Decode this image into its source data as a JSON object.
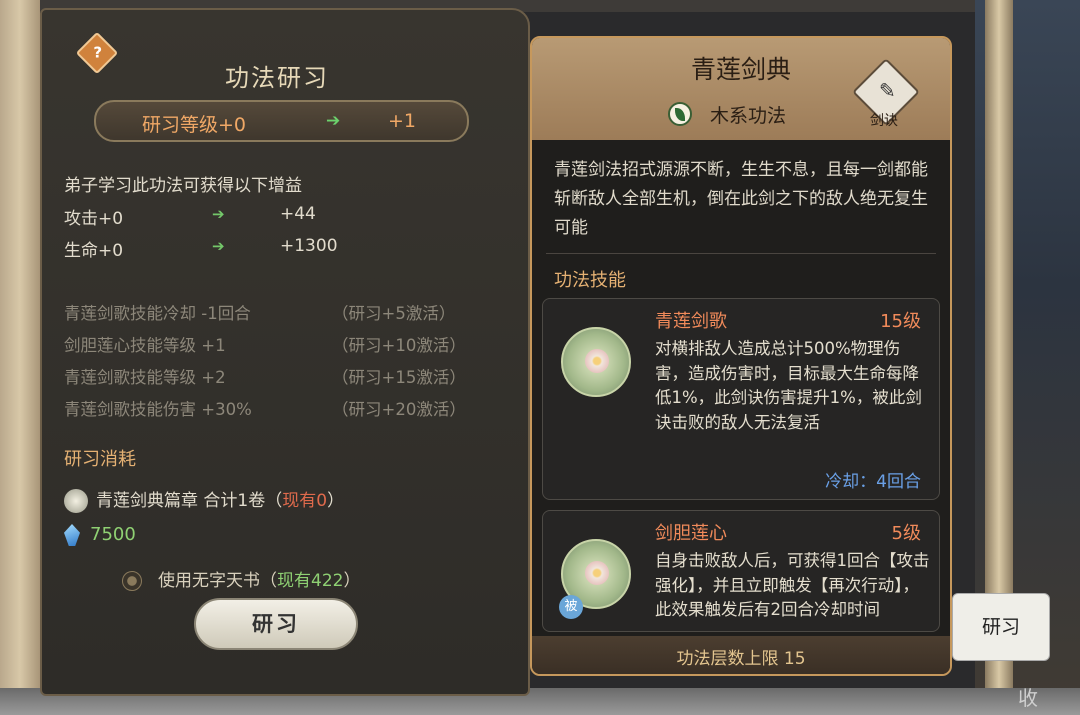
{
  "left": {
    "help": "?",
    "title": "功法研习",
    "level_label": "研习等级+0",
    "level_arrow": "➔",
    "level_next": "+1",
    "gain_heading": "弟子学习此功法可获得以下增益",
    "stats": [
      {
        "name": "攻击+0",
        "value": "+44"
      },
      {
        "name": "生命+0",
        "value": "+1300"
      }
    ],
    "bonuses": [
      {
        "name": "青莲剑歌技能冷却 -1回合",
        "cond": "（研习+5激活）"
      },
      {
        "name": "剑胆莲心技能等级 +1",
        "cond": "（研习+10激活）"
      },
      {
        "name": "青莲剑歌技能等级 +2",
        "cond": "（研习+15激活）"
      },
      {
        "name": "青莲剑歌技能伤害 +30%",
        "cond": "（研习+20激活）"
      }
    ],
    "cost_title": "研习消耗",
    "cost_item": "青莲剑典篇章 合计1卷（",
    "cost_have": "现有0",
    "cost_close": "）",
    "stone_amount": "7500",
    "book_option": "使用无字天书（",
    "book_have": "现有422",
    "book_close": "）",
    "study_button": "研习"
  },
  "right": {
    "title": "青莲剑典",
    "element": "木系功法",
    "sword_icon": "✎",
    "sword_label": "剑诀",
    "description": "青莲剑法招式源源不断，生生不息，且每一剑都能斩断敌人全部生机，倒在此剑之下的敌人绝无复生可能",
    "skills_title": "功法技能",
    "skills": [
      {
        "name": "青莲剑歌",
        "level": "15级",
        "desc": "对横排敌人造成总计500%物理伤害，造成伤害时，目标最大生命每降低1%，此剑诀伤害提升1%，被此剑诀击败的敌人无法复活",
        "cooldown": "冷却：4回合"
      },
      {
        "name": "剑胆莲心",
        "level": "5级",
        "tag": "被",
        "desc": "自身击败敌人后，可获得1回合【攻击强化】，并且立即触发【再次行动】，此效果触发后有2回合冷却时间"
      }
    ],
    "footer": "功法层数上限 15"
  },
  "side": {
    "study_button": "研习",
    "collect": "收"
  },
  "colors": {
    "accent_orange": "#f0a866",
    "green": "#8fd173",
    "red": "#e06a4c",
    "panel_gold": "#c6985c"
  }
}
